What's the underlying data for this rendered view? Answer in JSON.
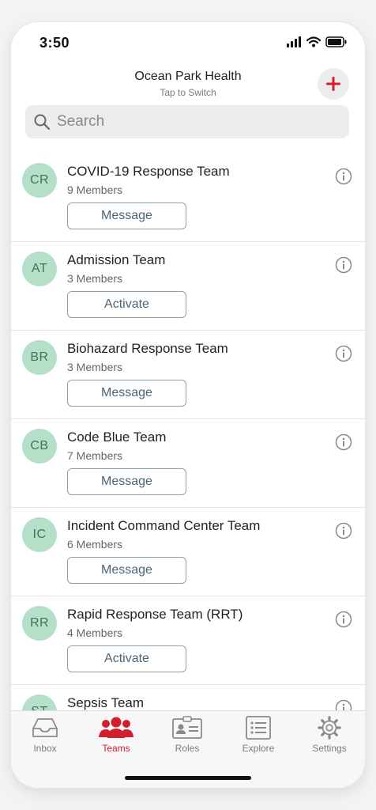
{
  "status": {
    "time": "3:50"
  },
  "header": {
    "org_name": "Ocean Park Health",
    "subtitle": "Tap to Switch",
    "add_icon": "plus-icon"
  },
  "search": {
    "placeholder": "Search",
    "value": ""
  },
  "teams": [
    {
      "initials": "CR",
      "name": "COVID-19 Response Team",
      "members": "9 Members",
      "action": "Message"
    },
    {
      "initials": "AT",
      "name": "Admission Team",
      "members": "3 Members",
      "action": "Activate"
    },
    {
      "initials": "BR",
      "name": "Biohazard Response Team",
      "members": "3 Members",
      "action": "Message"
    },
    {
      "initials": "CB",
      "name": "Code Blue Team",
      "members": "7 Members",
      "action": "Message"
    },
    {
      "initials": "IC",
      "name": "Incident Command Center Team",
      "members": "6 Members",
      "action": "Message"
    },
    {
      "initials": "RR",
      "name": "Rapid Response Team (RRT)",
      "members": "4 Members",
      "action": "Activate"
    },
    {
      "initials": "ST",
      "name": "Sepsis Team",
      "members": "",
      "action": ""
    }
  ],
  "tabs": [
    {
      "label": "Inbox",
      "icon": "inbox-icon",
      "active": false
    },
    {
      "label": "Teams",
      "icon": "teams-icon",
      "active": true
    },
    {
      "label": "Roles",
      "icon": "roles-icon",
      "active": false
    },
    {
      "label": "Explore",
      "icon": "explore-icon",
      "active": false
    },
    {
      "label": "Settings",
      "icon": "settings-icon",
      "active": false
    }
  ],
  "colors": {
    "accent": "#d21f2f",
    "avatar_bg": "#b4e0c9",
    "button_border": "#8fa0ad"
  }
}
